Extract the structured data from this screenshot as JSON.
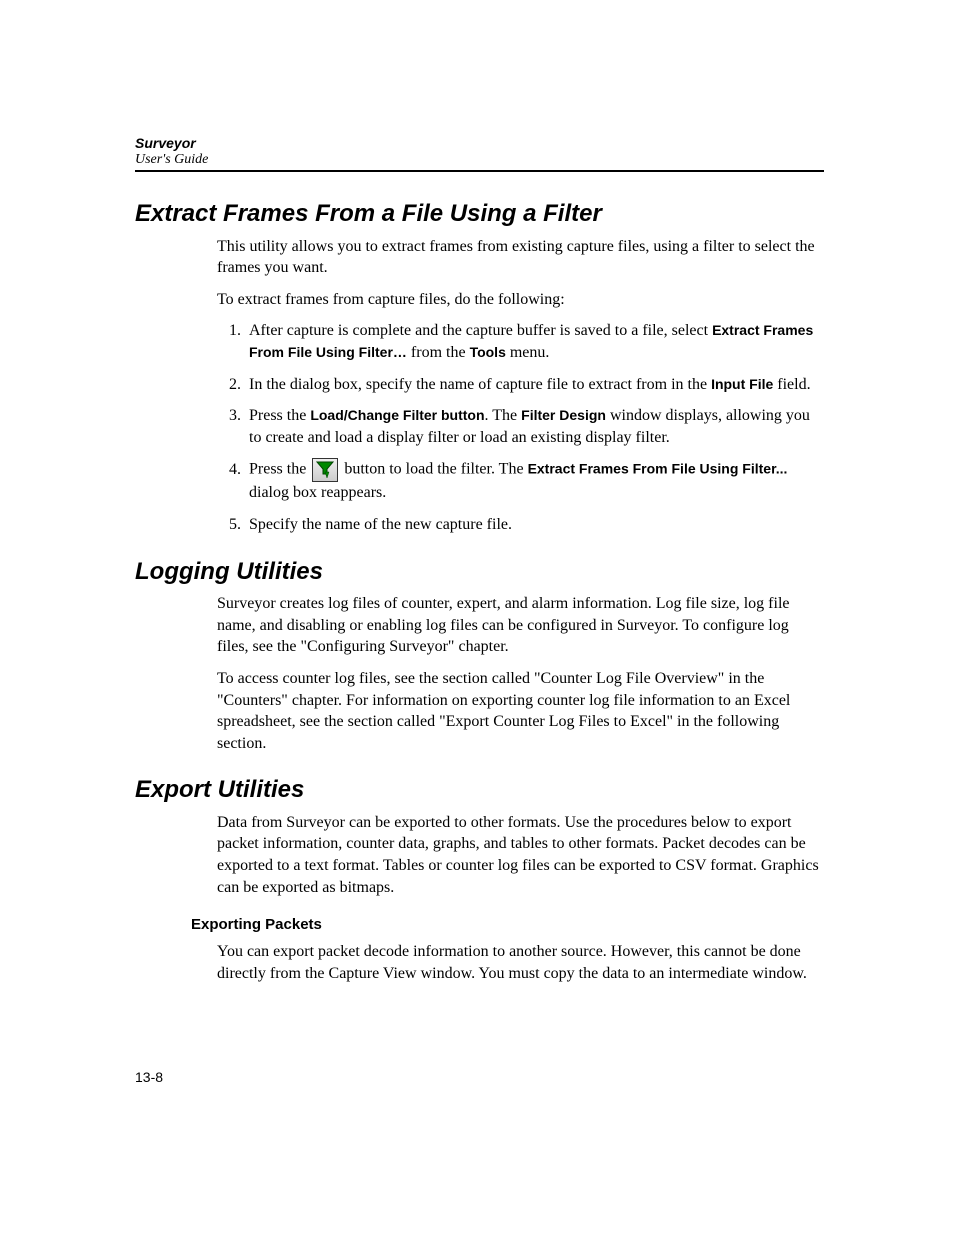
{
  "header": {
    "product": "Surveyor",
    "doc": "User's Guide"
  },
  "section1": {
    "title": "Extract Frames From a File Using a Filter",
    "intro": "This utility allows you to extract frames from existing capture files, using a filter to select the frames you want.",
    "lead": "To extract frames from capture files, do the following:",
    "steps": {
      "s1_a": "After capture is complete and the capture buffer is saved to a file, select ",
      "s1_b": "Extract Frames From File Using  Filter…",
      "s1_c": " from the ",
      "s1_d": "Tools",
      "s1_e": " menu.",
      "s2_a": "In the dialog box, specify the name of capture file to extract from in the ",
      "s2_b": "Input File",
      "s2_c": " field.",
      "s3_a": "Press the ",
      "s3_b": "Load/Change Filter button",
      "s3_c": ". The ",
      "s3_d": "Filter Design",
      "s3_e": " window displays, allowing you to create and load a display filter or load an existing display filter.",
      "s4_a": "Press the ",
      "s4_b": " button to load the filter. The ",
      "s4_c": "Extract Frames From File Using Filter...",
      "s4_d": " dialog box reappears.",
      "s5": "Specify the name of the new capture file."
    }
  },
  "section2": {
    "title": "Logging Utilities",
    "p1": "Surveyor creates log files of counter, expert, and alarm information. Log file size, log file name, and disabling or enabling log files can be configured in Surveyor. To configure log files, see the \"Configuring Surveyor\" chapter.",
    "p2": "To access counter log files, see the section called \"Counter Log File Overview\" in the \"Counters\" chapter. For information on exporting counter log file information to an Excel spreadsheet, see the section called \"Export Counter Log Files to Excel\" in the following section."
  },
  "section3": {
    "title": "Export Utilities",
    "p1": "Data from Surveyor can be exported to other formats. Use the procedures below to export packet information, counter data, graphs, and tables to other formats. Packet decodes can be exported to a text format. Tables or counter log files can be exported to CSV format. Graphics can be exported as bitmaps.",
    "sub1": {
      "title": "Exporting Packets",
      "p1": "You can export packet decode information to another source. However, this cannot be done directly from the Capture View window. You must copy the data to an intermediate window."
    }
  },
  "icons": {
    "filter_load": "filter-load-icon"
  },
  "page_number": "13-8"
}
